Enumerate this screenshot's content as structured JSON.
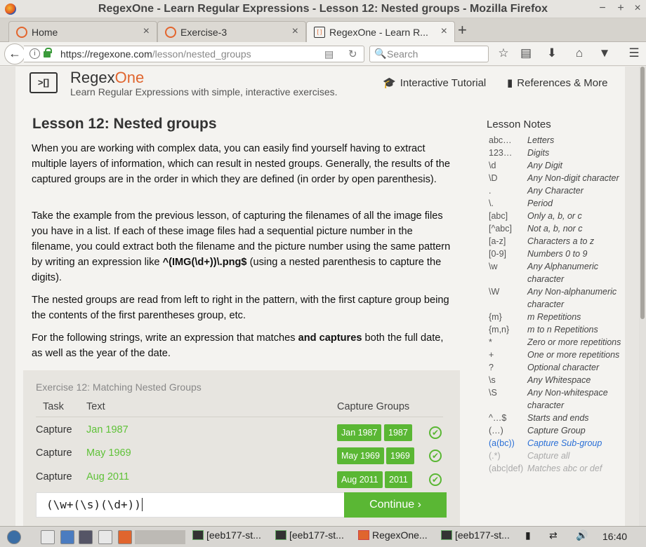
{
  "window": {
    "title": "RegexOne - Learn Regular Expressions - Lesson 12: Nested groups - Mozilla Firefox",
    "controls": [
      "−",
      "+",
      "×"
    ]
  },
  "tabs": [
    {
      "label": "Home",
      "close": "×"
    },
    {
      "label": "Exercise-3",
      "close": "×"
    },
    {
      "label": "RegexOne - Learn R...",
      "close": "×"
    }
  ],
  "new_tab": "+",
  "navbar": {
    "url_host": "https://regexone.com",
    "url_path": "/lesson/nested_groups",
    "search_placeholder": "Search"
  },
  "site": {
    "logo_text": ">[]",
    "brand_prefix": "Regex",
    "brand_suffix": "One",
    "tagline": "Learn Regular Expressions with simple, interactive exercises.",
    "link_tutorial": "Interactive Tutorial",
    "link_refs": "References & More"
  },
  "lesson": {
    "title": "Lesson 12: Nested groups",
    "p1": "When you are working with complex data, you can easily find yourself having to extract multiple layers of information, which can result in nested groups. Generally, the results of the captured groups are in the order in which they are defined (in order by open parenthesis).",
    "p2_a": "Take the example from the previous lesson, of capturing the filenames of all the image files you have in a list. If each of these image files had a sequential picture number in the filename, you could extract both the filename and the picture number using the same pattern by writing an expression like ",
    "p2_code": "^(IMG(\\d+))\\.png$",
    "p2_b": " (using a nested parenthesis to capture the digits).",
    "p3": "The nested groups are read from left to right in the pattern, with the first capture group being the contents of the first parentheses group, etc.",
    "p4_a": "For the following strings, write an expression that matches ",
    "p4_bold": "and captures",
    "p4_b": " both the full date, as well as the year of the date."
  },
  "notes": {
    "title": "Lesson Notes",
    "items": [
      {
        "k": "abc…",
        "v": "Letters"
      },
      {
        "k": "123…",
        "v": "Digits"
      },
      {
        "k": "\\d",
        "v": "Any Digit"
      },
      {
        "k": "\\D",
        "v": "Any Non-digit character"
      },
      {
        "k": ".",
        "v": "Any Character"
      },
      {
        "k": "\\.",
        "v": "Period"
      },
      {
        "k": "[abc]",
        "v": "Only a, b, or c"
      },
      {
        "k": "[^abc]",
        "v": "Not a, b, nor c"
      },
      {
        "k": "[a-z]",
        "v": "Characters a to z"
      },
      {
        "k": "[0-9]",
        "v": "Numbers 0 to 9"
      },
      {
        "k": "\\w",
        "v": "Any Alphanumeric character"
      },
      {
        "k": "\\W",
        "v": "Any Non-alphanumeric character"
      },
      {
        "k": "{m}",
        "v": "m Repetitions"
      },
      {
        "k": "{m,n}",
        "v": "m to n Repetitions"
      },
      {
        "k": "*",
        "v": "Zero or more repetitions"
      },
      {
        "k": "+",
        "v": "One or more repetitions"
      },
      {
        "k": "?",
        "v": "Optional character"
      },
      {
        "k": "\\s",
        "v": "Any Whitespace"
      },
      {
        "k": "\\S",
        "v": "Any Non-whitespace character"
      },
      {
        "k": "^…$",
        "v": "Starts and ends"
      },
      {
        "k": "(…)",
        "v": "Capture Group"
      },
      {
        "k": "(a(bc))",
        "v": "Capture Sub-group"
      },
      {
        "k": "(.*)",
        "v": "Capture all"
      },
      {
        "k": "(abc|def)",
        "v": "Matches abc or def"
      }
    ]
  },
  "exercise": {
    "title": "Exercise 12: Matching Nested Groups",
    "col_task": "Task",
    "col_text": "Text",
    "col_groups": "Capture Groups",
    "rows": [
      {
        "task": "Capture",
        "text": "Jan 1987",
        "g1": "Jan 1987",
        "g2": "1987",
        "ok": "✔"
      },
      {
        "task": "Capture",
        "text": "May 1969",
        "g1": "May 1969",
        "g2": "1969",
        "ok": "✔"
      },
      {
        "task": "Capture",
        "text": "Aug 2011",
        "g1": "Aug 2011",
        "g2": "2011",
        "ok": "✔"
      }
    ],
    "answer": "(\\w+(\\s)(\\d+))",
    "continue": "Continue ›"
  },
  "taskbar": {
    "items": [
      "[eeb177-st...",
      "[eeb177-st...",
      "RegexOne...",
      "[eeb177-st..."
    ],
    "clock": "16:40"
  }
}
